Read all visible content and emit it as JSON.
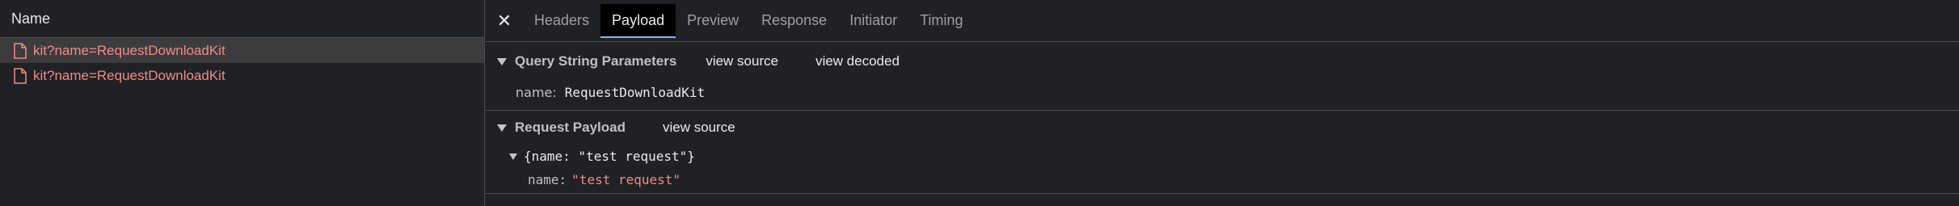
{
  "list": {
    "header": "Name",
    "requests": [
      {
        "label": "kit?name=RequestDownloadKit",
        "selected": true
      },
      {
        "label": "kit?name=RequestDownloadKit",
        "selected": false
      }
    ]
  },
  "tabs": {
    "close_icon": "close-icon",
    "items": [
      "Headers",
      "Payload",
      "Preview",
      "Response",
      "Initiator",
      "Timing"
    ],
    "active": "Payload"
  },
  "query_params": {
    "title": "Query String Parameters",
    "view_source": "view source",
    "view_decoded": "view decoded",
    "param_key": "name:",
    "param_value": "RequestDownloadKit"
  },
  "payload": {
    "title": "Request Payload",
    "view_source": "view source",
    "object_summary": "{name: \"test request\"}",
    "field_key": "name:",
    "field_value": "\"test request\""
  },
  "colors": {
    "background": "#202124",
    "error_text": "#f28b82",
    "active_tab_underline": "#8ab4f8"
  }
}
